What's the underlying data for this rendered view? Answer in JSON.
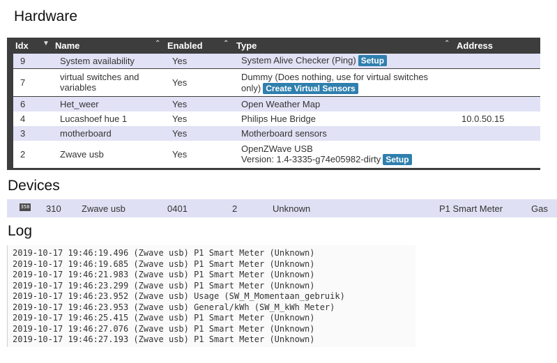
{
  "sections": {
    "hardware": "Hardware",
    "devices": "Devices",
    "log": "Log"
  },
  "hardware_table": {
    "columns": [
      "Idx",
      "Name",
      "Enabled",
      "Type",
      "Address"
    ],
    "rows": [
      {
        "idx": "9",
        "name": "System availability",
        "enabled": "Yes",
        "type": "System Alive Checker (Ping)",
        "button": "Setup",
        "address": ""
      },
      {
        "idx": "7",
        "name": "virtual switches and variables",
        "enabled": "Yes",
        "type": "Dummy (Does nothing, use for virtual switches only)",
        "button": "Create Virtual Sensors",
        "address": ""
      },
      {
        "idx": "6",
        "name": "Het_weer",
        "enabled": "Yes",
        "type": "Open Weather Map",
        "button": "",
        "address": ""
      },
      {
        "idx": "4",
        "name": "Lucashoef hue 1",
        "enabled": "Yes",
        "type": "Philips Hue Bridge",
        "button": "",
        "address": "10.0.50.15"
      },
      {
        "idx": "3",
        "name": "motherboard",
        "enabled": "Yes",
        "type": "Motherboard sensors",
        "button": "",
        "address": ""
      },
      {
        "idx": "2",
        "name": "Zwave usb",
        "enabled": "Yes",
        "type": "OpenZWave USB",
        "type_line2": "Version: 1.4-3335-g74e05982-dirty",
        "button": "Setup",
        "address": ""
      }
    ]
  },
  "device_row": {
    "icon_text": "358",
    "idx": "310",
    "hardware": "Zwave usb",
    "id": "0401",
    "unit": "2",
    "name": "Unknown",
    "type": "P1 Smart Meter",
    "subtype": "Gas"
  },
  "log_lines": [
    "2019-10-17 19:46:19.496 (Zwave usb) P1 Smart Meter (Unknown)",
    "2019-10-17 19:46:19.685 (Zwave usb) P1 Smart Meter (Unknown)",
    "2019-10-17 19:46:21.983 (Zwave usb) P1 Smart Meter (Unknown)",
    "2019-10-17 19:46:23.299 (Zwave usb) P1 Smart Meter (Unknown)",
    "2019-10-17 19:46:23.952 (Zwave usb) Usage (SW_M_Momentaan_gebruik)",
    "2019-10-17 19:46:23.953 (Zwave usb) General/kWh (SW_M_kWh Meter)",
    "2019-10-17 19:46:25.415 (Zwave usb) P1 Smart Meter (Unknown)",
    "2019-10-17 19:46:27.076 (Zwave usb) P1 Smart Meter (Unknown)",
    "2019-10-17 19:46:27.193 (Zwave usb) P1 Smart Meter (Unknown)"
  ]
}
